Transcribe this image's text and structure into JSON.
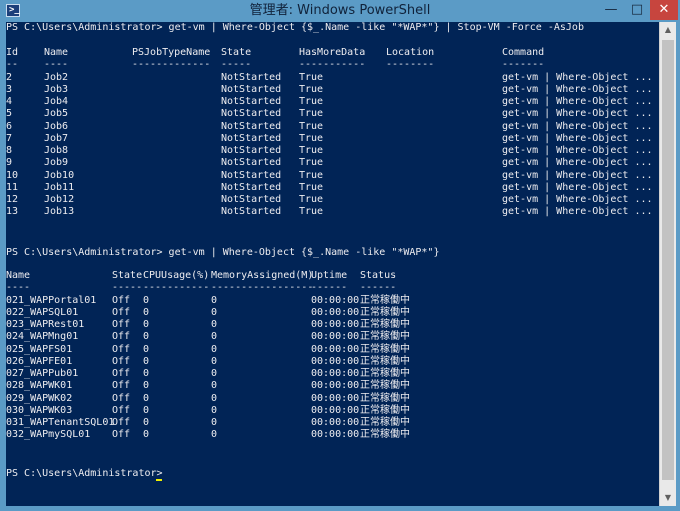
{
  "window": {
    "title": "管理者: Windows PowerShell",
    "icon_text": ">_",
    "icon_name": "powershell-icon",
    "minimize_label": "—",
    "maximize_label": "□",
    "close_label": "✕"
  },
  "colors": {
    "console_bg": "#012456",
    "console_text": "#eeedf0",
    "titlebar": "#5b9bc6",
    "close": "#c7453e",
    "cursor": "#f0f000"
  },
  "commands": {
    "cmd1": "PS C:\\Users\\Administrator> get-vm | Where-Object {$_.Name -like \"*WAP*\"} | Stop-VM -Force -AsJob",
    "cmd2": "PS C:\\Users\\Administrator> get-vm | Where-Object {$_.Name -like \"*WAP*\"}",
    "prompt": "PS C:\\Users\\Administrator> "
  },
  "jobs": {
    "headers": [
      "Id",
      "Name",
      "PSJobTypeName",
      "State",
      "HasMoreData",
      "Location",
      "Command"
    ],
    "dashes": [
      "--",
      "----",
      "-------------",
      "-----",
      "-----------",
      "--------",
      "-------"
    ],
    "rows": [
      [
        "2",
        "Job2",
        "",
        "NotStarted",
        "True",
        "",
        "get-vm | Where-Object ..."
      ],
      [
        "3",
        "Job3",
        "",
        "NotStarted",
        "True",
        "",
        "get-vm | Where-Object ..."
      ],
      [
        "4",
        "Job4",
        "",
        "NotStarted",
        "True",
        "",
        "get-vm | Where-Object ..."
      ],
      [
        "5",
        "Job5",
        "",
        "NotStarted",
        "True",
        "",
        "get-vm | Where-Object ..."
      ],
      [
        "6",
        "Job6",
        "",
        "NotStarted",
        "True",
        "",
        "get-vm | Where-Object ..."
      ],
      [
        "7",
        "Job7",
        "",
        "NotStarted",
        "True",
        "",
        "get-vm | Where-Object ..."
      ],
      [
        "8",
        "Job8",
        "",
        "NotStarted",
        "True",
        "",
        "get-vm | Where-Object ..."
      ],
      [
        "9",
        "Job9",
        "",
        "NotStarted",
        "True",
        "",
        "get-vm | Where-Object ..."
      ],
      [
        "10",
        "Job10",
        "",
        "NotStarted",
        "True",
        "",
        "get-vm | Where-Object ..."
      ],
      [
        "11",
        "Job11",
        "",
        "NotStarted",
        "True",
        "",
        "get-vm | Where-Object ..."
      ],
      [
        "12",
        "Job12",
        "",
        "NotStarted",
        "True",
        "",
        "get-vm | Where-Object ..."
      ],
      [
        "13",
        "Job13",
        "",
        "NotStarted",
        "True",
        "",
        "get-vm | Where-Object ..."
      ]
    ]
  },
  "vms": {
    "headers": [
      "Name",
      "State",
      "CPUUsage(%)",
      "MemoryAssigned(M)",
      "Uptime",
      "Status"
    ],
    "dashes": [
      "----",
      "-----",
      "-----------",
      "-----------------",
      "------",
      "------"
    ],
    "rows": [
      [
        "021_WAPPortal01",
        "Off",
        "0",
        "0",
        "00:00:00",
        "正常稼働中"
      ],
      [
        "022_WAPSQL01",
        "Off",
        "0",
        "0",
        "00:00:00",
        "正常稼働中"
      ],
      [
        "023_WAPRest01",
        "Off",
        "0",
        "0",
        "00:00:00",
        "正常稼働中"
      ],
      [
        "024_WAPMng01",
        "Off",
        "0",
        "0",
        "00:00:00",
        "正常稼働中"
      ],
      [
        "025_WAPFS01",
        "Off",
        "0",
        "0",
        "00:00:00",
        "正常稼働中"
      ],
      [
        "026_WAPFE01",
        "Off",
        "0",
        "0",
        "00:00:00",
        "正常稼働中"
      ],
      [
        "027_WAPPub01",
        "Off",
        "0",
        "0",
        "00:00:00",
        "正常稼働中"
      ],
      [
        "028_WAPWK01",
        "Off",
        "0",
        "0",
        "00:00:00",
        "正常稼働中"
      ],
      [
        "029_WAPWK02",
        "Off",
        "0",
        "0",
        "00:00:00",
        "正常稼働中"
      ],
      [
        "030_WAPWK03",
        "Off",
        "0",
        "0",
        "00:00:00",
        "正常稼働中"
      ],
      [
        "031_WAPTenantSQL01",
        "Off",
        "0",
        "0",
        "00:00:00",
        "正常稼働中"
      ],
      [
        "032_WAPmySQL01",
        "Off",
        "0",
        "0",
        "00:00:00",
        "正常稼働中"
      ]
    ]
  },
  "scrollbar": {
    "up_icon": "▲",
    "down_icon": "▼"
  }
}
